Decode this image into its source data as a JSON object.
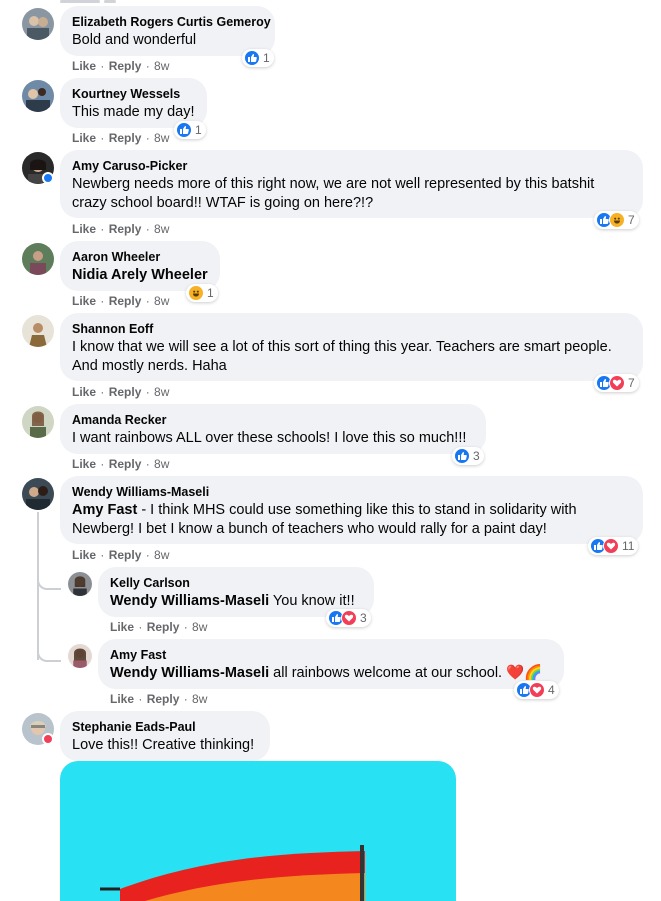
{
  "comments": [
    {
      "author": "Elizabeth Rogers Curtis Gemeroy",
      "text": "Bold and wonderful",
      "like": "Like",
      "reply": "Reply",
      "time": "8w",
      "reactions": "1"
    },
    {
      "author": "Kourtney Wessels",
      "text": "This made my day!",
      "like": "Like",
      "reply": "Reply",
      "time": "8w",
      "reactions": "1"
    },
    {
      "author": "Amy Caruso-Picker",
      "text": "Newberg needs more of this right now, we are not well represented by this batshit crazy school board!! WTAF is going on here?!?",
      "like": "Like",
      "reply": "Reply",
      "time": "8w",
      "reactions": "7"
    },
    {
      "author": "Aaron Wheeler",
      "mention": "Nidia Arely Wheeler",
      "text": "",
      "like": "Like",
      "reply": "Reply",
      "time": "8w",
      "reactions": "1"
    },
    {
      "author": "Shannon Eoff",
      "text": "I know that we will see a lot of this sort of thing this year. Teachers are smart people. And mostly nerds. Haha",
      "like": "Like",
      "reply": "Reply",
      "time": "8w",
      "reactions": "7"
    },
    {
      "author": "Amanda Recker",
      "text": "I want rainbows ALL over these schools! I love this so much!!!",
      "like": "Like",
      "reply": "Reply",
      "time": "8w",
      "reactions": "3"
    },
    {
      "author": "Wendy Williams-Maseli",
      "mention": "Amy Fast",
      "text": "- I think MHS could use something like this to stand in solidarity with Newberg! I bet I know a bunch of teachers who would rally for a paint day!",
      "like": "Like",
      "reply": "Reply",
      "time": "8w",
      "reactions": "11"
    },
    {
      "author": "Kelly Carlson",
      "mention": "Wendy Williams-Maseli",
      "text": " You know it!!",
      "like": "Like",
      "reply": "Reply",
      "time": "8w",
      "reactions": "3"
    },
    {
      "author": "Amy Fast",
      "mention": "Wendy Williams-Maseli",
      "text": " all rainbows welcome at our school. ❤️🌈",
      "like": "Like",
      "reply": "Reply",
      "time": "8w",
      "reactions": "4"
    },
    {
      "author": "Stephanie Eads-Paul",
      "text": "Love this!! Creative thinking!"
    }
  ],
  "colors": {
    "like": "#1877f2",
    "love": "#f33e58",
    "haha": "#f7b125",
    "bubble": "#f0f2f5",
    "meta": "#65676b",
    "image_bg": "#28e2f4"
  }
}
